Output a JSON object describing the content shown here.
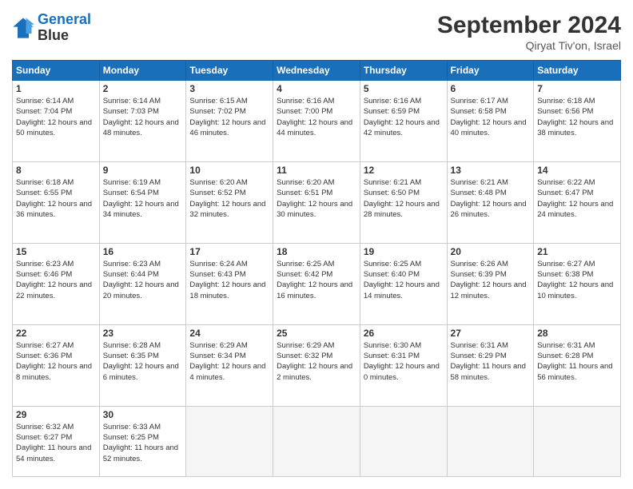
{
  "header": {
    "logo_line1": "General",
    "logo_line2": "Blue",
    "month": "September 2024",
    "location": "Qiryat Tiv'on, Israel"
  },
  "weekdays": [
    "Sunday",
    "Monday",
    "Tuesday",
    "Wednesday",
    "Thursday",
    "Friday",
    "Saturday"
  ],
  "days": [
    {
      "date": "",
      "info": ""
    },
    {
      "date": "",
      "info": ""
    },
    {
      "date": "",
      "info": ""
    },
    {
      "date": "",
      "info": ""
    },
    {
      "date": "",
      "info": ""
    },
    {
      "date": "",
      "info": ""
    },
    {
      "date": "7",
      "sunrise": "6:18 AM",
      "sunset": "6:56 PM",
      "daylight": "12 hours and 38 minutes."
    },
    {
      "date": "8",
      "sunrise": "6:18 AM",
      "sunset": "6:55 PM",
      "daylight": "12 hours and 36 minutes."
    },
    {
      "date": "9",
      "sunrise": "6:19 AM",
      "sunset": "6:54 PM",
      "daylight": "12 hours and 34 minutes."
    },
    {
      "date": "10",
      "sunrise": "6:20 AM",
      "sunset": "6:52 PM",
      "daylight": "12 hours and 32 minutes."
    },
    {
      "date": "11",
      "sunrise": "6:20 AM",
      "sunset": "6:51 PM",
      "daylight": "12 hours and 30 minutes."
    },
    {
      "date": "12",
      "sunrise": "6:21 AM",
      "sunset": "6:50 PM",
      "daylight": "12 hours and 28 minutes."
    },
    {
      "date": "13",
      "sunrise": "6:21 AM",
      "sunset": "6:48 PM",
      "daylight": "12 hours and 26 minutes."
    },
    {
      "date": "14",
      "sunrise": "6:22 AM",
      "sunset": "6:47 PM",
      "daylight": "12 hours and 24 minutes."
    },
    {
      "date": "15",
      "sunrise": "6:23 AM",
      "sunset": "6:46 PM",
      "daylight": "12 hours and 22 minutes."
    },
    {
      "date": "16",
      "sunrise": "6:23 AM",
      "sunset": "6:44 PM",
      "daylight": "12 hours and 20 minutes."
    },
    {
      "date": "17",
      "sunrise": "6:24 AM",
      "sunset": "6:43 PM",
      "daylight": "12 hours and 18 minutes."
    },
    {
      "date": "18",
      "sunrise": "6:25 AM",
      "sunset": "6:42 PM",
      "daylight": "12 hours and 16 minutes."
    },
    {
      "date": "19",
      "sunrise": "6:25 AM",
      "sunset": "6:40 PM",
      "daylight": "12 hours and 14 minutes."
    },
    {
      "date": "20",
      "sunrise": "6:26 AM",
      "sunset": "6:39 PM",
      "daylight": "12 hours and 12 minutes."
    },
    {
      "date": "21",
      "sunrise": "6:27 AM",
      "sunset": "6:38 PM",
      "daylight": "12 hours and 10 minutes."
    },
    {
      "date": "22",
      "sunrise": "6:27 AM",
      "sunset": "6:36 PM",
      "daylight": "12 hours and 8 minutes."
    },
    {
      "date": "23",
      "sunrise": "6:28 AM",
      "sunset": "6:35 PM",
      "daylight": "12 hours and 6 minutes."
    },
    {
      "date": "24",
      "sunrise": "6:29 AM",
      "sunset": "6:34 PM",
      "daylight": "12 hours and 4 minutes."
    },
    {
      "date": "25",
      "sunrise": "6:29 AM",
      "sunset": "6:32 PM",
      "daylight": "12 hours and 2 minutes."
    },
    {
      "date": "26",
      "sunrise": "6:30 AM",
      "sunset": "6:31 PM",
      "daylight": "12 hours and 0 minutes."
    },
    {
      "date": "27",
      "sunrise": "6:31 AM",
      "sunset": "6:29 PM",
      "daylight": "11 hours and 58 minutes."
    },
    {
      "date": "28",
      "sunrise": "6:31 AM",
      "sunset": "6:28 PM",
      "daylight": "11 hours and 56 minutes."
    },
    {
      "date": "29",
      "sunrise": "6:32 AM",
      "sunset": "6:27 PM",
      "daylight": "11 hours and 54 minutes."
    },
    {
      "date": "30",
      "sunrise": "6:33 AM",
      "sunset": "6:25 PM",
      "daylight": "11 hours and 52 minutes."
    }
  ],
  "week1": [
    {
      "date": "1",
      "sunrise": "6:14 AM",
      "sunset": "7:04 PM",
      "daylight": "12 hours and 50 minutes."
    },
    {
      "date": "2",
      "sunrise": "6:14 AM",
      "sunset": "7:03 PM",
      "daylight": "12 hours and 48 minutes."
    },
    {
      "date": "3",
      "sunrise": "6:15 AM",
      "sunset": "7:02 PM",
      "daylight": "12 hours and 46 minutes."
    },
    {
      "date": "4",
      "sunrise": "6:16 AM",
      "sunset": "7:00 PM",
      "daylight": "12 hours and 44 minutes."
    },
    {
      "date": "5",
      "sunrise": "6:16 AM",
      "sunset": "6:59 PM",
      "daylight": "12 hours and 42 minutes."
    },
    {
      "date": "6",
      "sunrise": "6:17 AM",
      "sunset": "6:58 PM",
      "daylight": "12 hours and 40 minutes."
    },
    {
      "date": "7",
      "sunrise": "6:18 AM",
      "sunset": "6:56 PM",
      "daylight": "12 hours and 38 minutes."
    }
  ]
}
